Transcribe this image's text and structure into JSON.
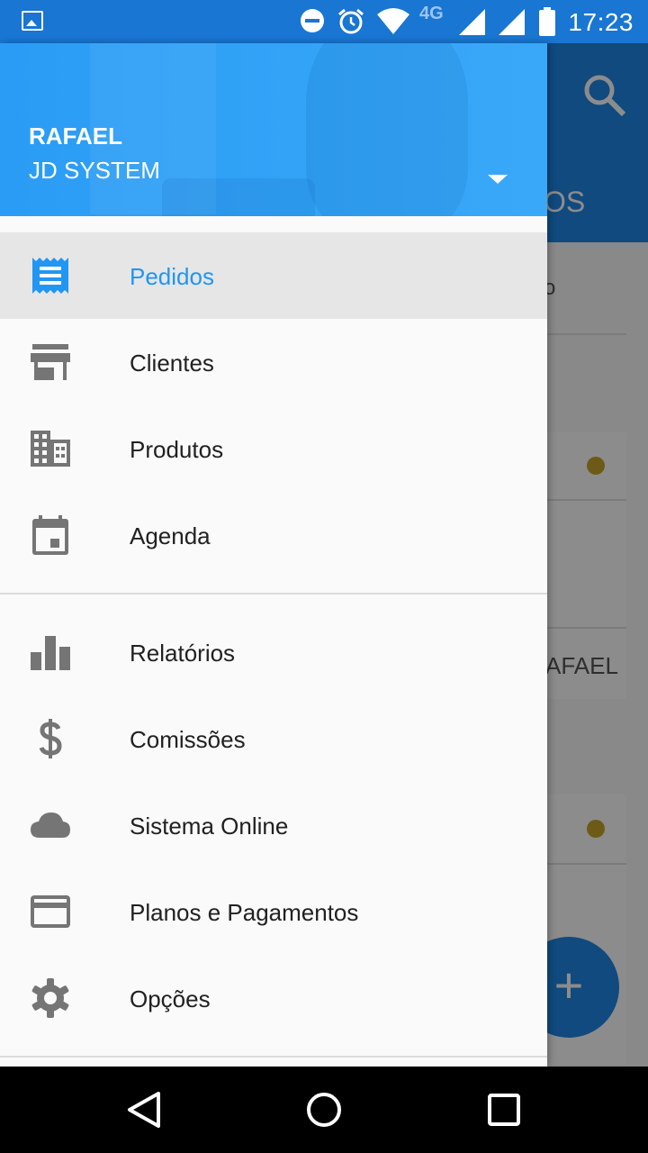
{
  "status_bar": {
    "time": "17:23",
    "network": "4G"
  },
  "background_app": {
    "title_fragment": "OS",
    "row_fragment": "o",
    "name_fragment": "AFAEL",
    "fab_label": "+"
  },
  "drawer": {
    "header": {
      "user_name": "RAFAEL",
      "company": "JD SYSTEM"
    },
    "items": [
      {
        "label": "Pedidos",
        "icon": "receipt-icon",
        "active": true
      },
      {
        "label": "Clientes",
        "icon": "store-icon",
        "active": false
      },
      {
        "label": "Produtos",
        "icon": "business-icon",
        "active": false
      },
      {
        "label": "Agenda",
        "icon": "calendar-icon",
        "active": false
      },
      {
        "label": "Relatórios",
        "icon": "bar-chart-icon",
        "active": false
      },
      {
        "label": "Comissões",
        "icon": "dollar-icon",
        "active": false
      },
      {
        "label": "Sistema Online",
        "icon": "cloud-icon",
        "active": false
      },
      {
        "label": "Planos e Pagamentos",
        "icon": "credit-card-icon",
        "active": false
      },
      {
        "label": "Opções",
        "icon": "settings-icon",
        "active": false
      }
    ]
  },
  "colors": {
    "primary": "#1976d2",
    "accent": "#2196f3",
    "icon_gray": "#757575",
    "status_dot": "#c9a42a"
  }
}
